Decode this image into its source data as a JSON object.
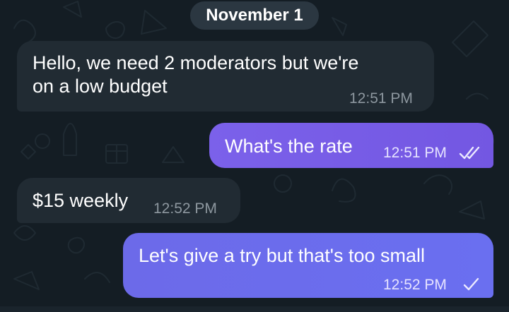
{
  "colors": {
    "background": "#141d24",
    "incoming_bubble": "#212b33",
    "outgoing_bubble_a": "#7b61ea",
    "outgoing_bubble_b": "#6a6ff0",
    "date_pill": "#2e3a44",
    "time_incoming": "#8d979f",
    "time_outgoing": "#e6e3ff"
  },
  "chat": {
    "date_separator": "November 1",
    "messages": [
      {
        "direction": "incoming",
        "lines": [
          "Hello, we need 2 moderators but we're",
          "on a low budget"
        ],
        "time": "12:51 PM"
      },
      {
        "direction": "outgoing",
        "lines": [
          "What's the rate"
        ],
        "time": "12:51 PM",
        "status_icon": "double-check-icon"
      },
      {
        "direction": "incoming",
        "lines": [
          "$15 weekly"
        ],
        "time": "12:52 PM"
      },
      {
        "direction": "outgoing",
        "lines": [
          "Let's give a try but that's too small"
        ],
        "time": "12:52 PM",
        "status_icon": "single-check-icon"
      }
    ]
  }
}
